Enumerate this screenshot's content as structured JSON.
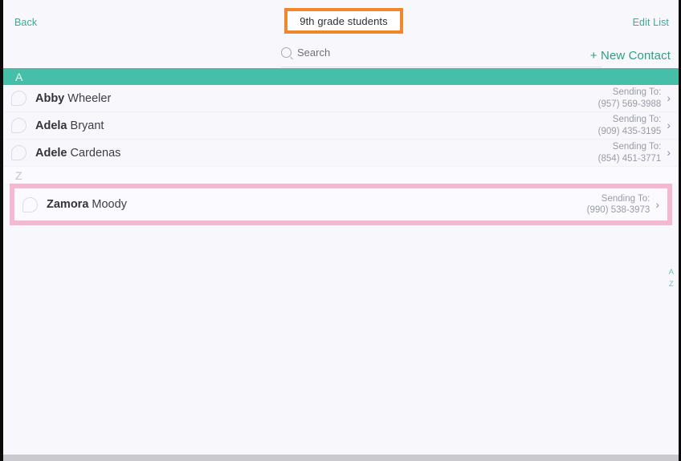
{
  "header": {
    "back_label": "Back",
    "title": "9th grade students",
    "edit_list_label": "Edit List",
    "highlight_color": "#f2862a"
  },
  "search": {
    "placeholder": "Search",
    "value": "",
    "icon": "search-icon",
    "new_contact_label": "+ New Contact"
  },
  "sections": [
    {
      "letter": "A",
      "style": "teal"
    },
    {
      "letter": "Z",
      "style": "plain"
    }
  ],
  "contacts": [
    {
      "first_name": "Abby",
      "last_name": " Wheeler",
      "sending_label": "Sending To:",
      "phone": "(957) 569-3988",
      "chevron": "›",
      "highlighted": false
    },
    {
      "first_name": "Adela",
      "last_name": " Bryant",
      "sending_label": "Sending To:",
      "phone": "(909) 435-3195",
      "chevron": "›",
      "highlighted": false
    },
    {
      "first_name": "Adele",
      "last_name": " Cardenas",
      "sending_label": "Sending To:",
      "phone": "(854) 451-3771",
      "chevron": "›",
      "highlighted": false
    },
    {
      "first_name": "Zamora",
      "last_name": " Moody",
      "sending_label": "Sending To:",
      "phone": "(990) 538-3973",
      "chevron": "›",
      "highlighted": true
    }
  ],
  "az_index": {
    "top": "A",
    "bottom": "Z"
  },
  "colors": {
    "teal": "#45bfa8",
    "link_teal": "#3aab94",
    "pink_highlight": "#f4b8d0",
    "orange_highlight": "#f2862a",
    "page_background": "#f8f8fc"
  }
}
